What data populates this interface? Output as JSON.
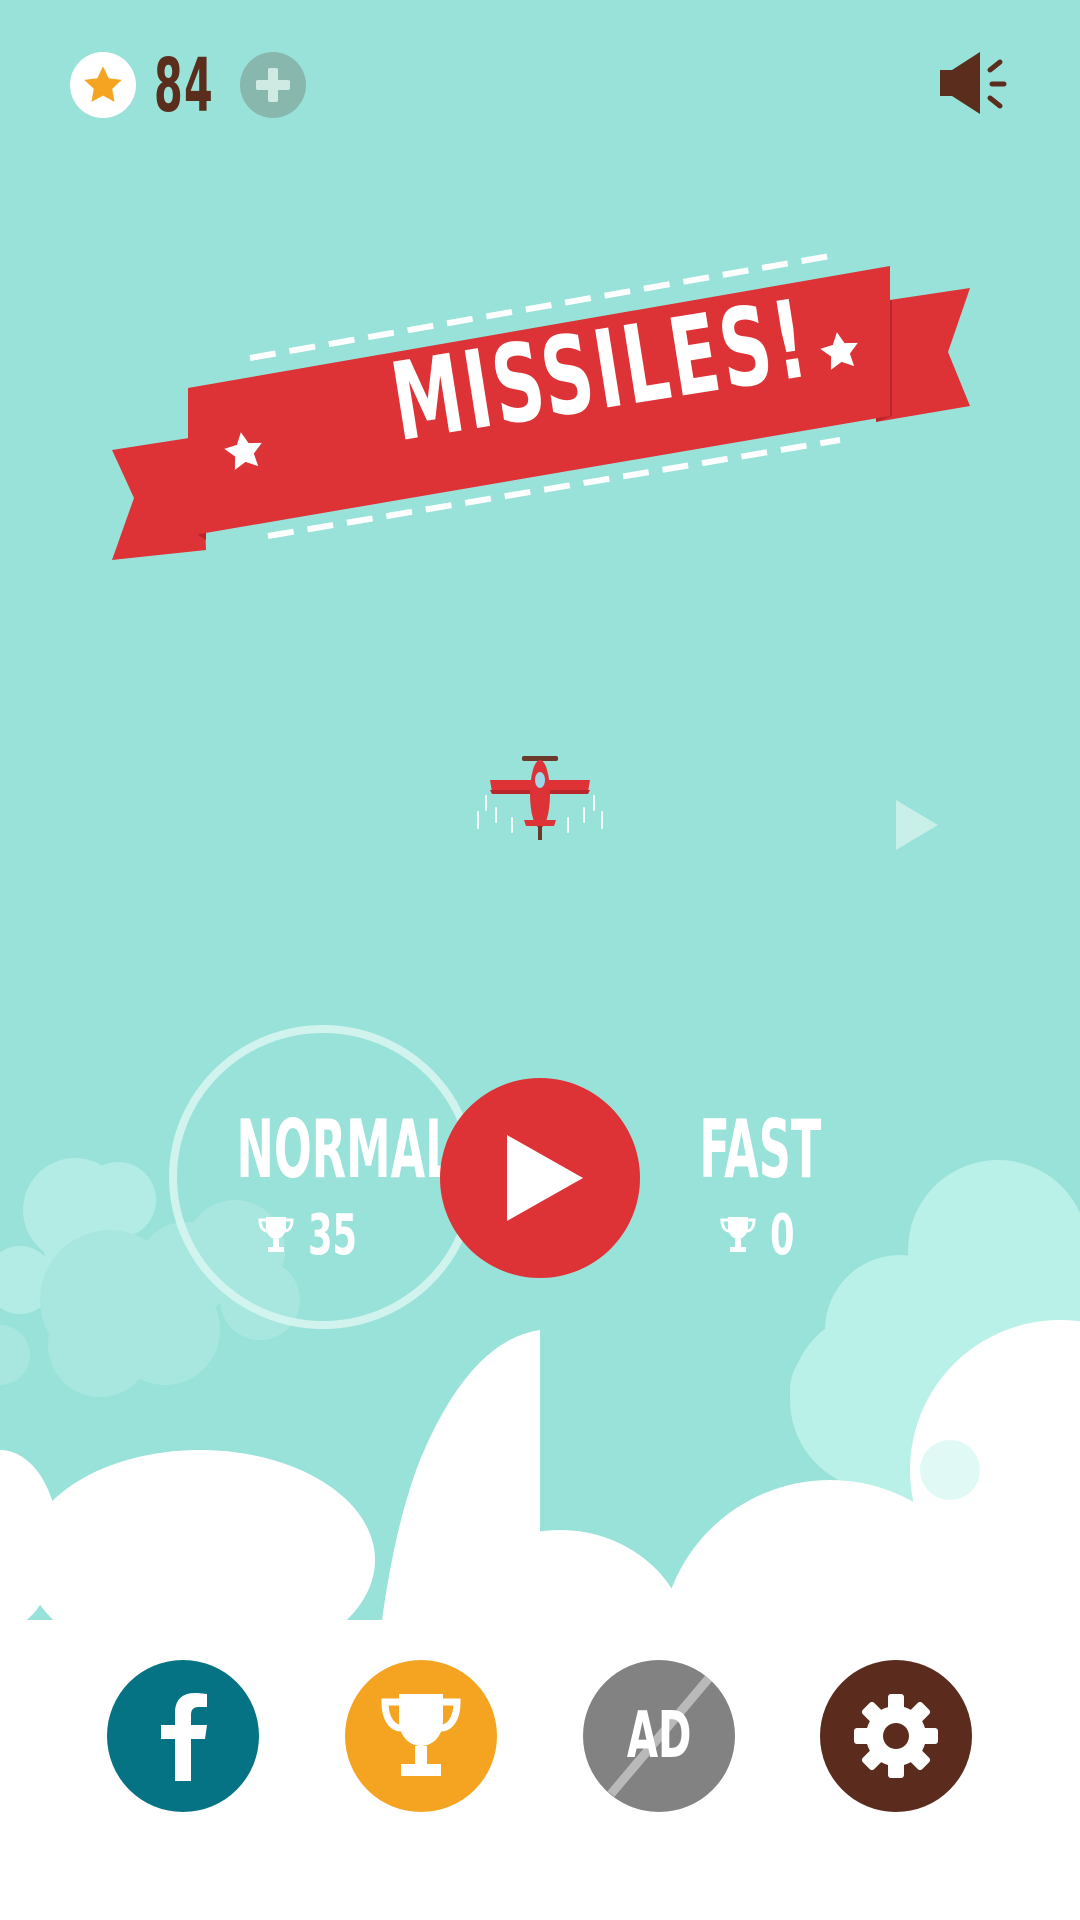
{
  "hud": {
    "coins": "84",
    "coin_icon": "star-icon",
    "add_icon": "plus-icon",
    "sound_icon": "speaker-on-icon"
  },
  "title": {
    "text": "MISSILES!"
  },
  "modes": {
    "normal": {
      "label": "NORMAL",
      "best": "35",
      "selected": true
    },
    "fast": {
      "label": "FAST",
      "best": "0",
      "selected": false
    }
  },
  "play": {
    "icon": "play-icon"
  },
  "bottom_bar": {
    "facebook_icon": "facebook-icon",
    "leaderboard_icon": "trophy-icon",
    "noads_label": "AD",
    "settings_icon": "gear-icon"
  },
  "colors": {
    "sky": "#98e2d9",
    "banner_red": "#dd3236",
    "dark_brown": "#5a2d1c",
    "facebook_teal": "#057384",
    "trophy_orange": "#f4a421",
    "noads_gray": "#828282"
  }
}
